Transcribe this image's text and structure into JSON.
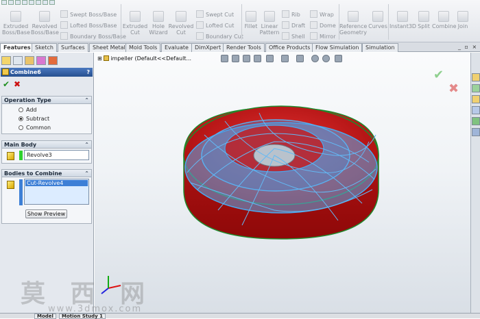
{
  "toolbar": {
    "extruded_boss": "Extruded\nBoss/Base",
    "revolved_boss": "Revolved\nBoss/Base",
    "swept_boss": "Swept Boss/Base",
    "lofted_boss": "Lofted Boss/Base",
    "boundary_boss": "Boundary Boss/Base",
    "extruded_cut": "Extruded\nCut",
    "hole_wizard": "Hole\nWizard",
    "revolved_cut": "Revolved\nCut",
    "swept_cut": "Swept Cut",
    "lofted_cut": "Lofted Cut",
    "boundary_cut": "Boundary Cut",
    "fillet": "Fillet",
    "linear_pattern": "Linear\nPattern",
    "rib": "Rib",
    "draft": "Draft",
    "shell": "Shell",
    "wrap": "Wrap",
    "dome": "Dome",
    "mirror": "Mirror",
    "reference_geometry": "Reference\nGeometry",
    "curves": "Curves",
    "instant3d": "Instant3D",
    "split": "Split",
    "combine": "Combine",
    "join": "Join"
  },
  "tabs": [
    "Features",
    "Sketch",
    "Surfaces",
    "Sheet Metal",
    "Mold Tools",
    "Evaluate",
    "DimXpert",
    "Render Tools",
    "Office Products",
    "Flow Simulation",
    "Simulation"
  ],
  "active_tab": "Features",
  "property_manager": {
    "title": "Combine6",
    "help": "?",
    "ok": "✔",
    "cancel": "✖",
    "operation_type": {
      "heading": "Operation Type",
      "options": [
        "Add",
        "Subtract",
        "Common"
      ],
      "selected": "Subtract"
    },
    "main_body": {
      "heading": "Main Body",
      "value": "Revolve3"
    },
    "bodies_to_combine": {
      "heading": "Bodies to Combine",
      "items": [
        "Cut-Revolve4"
      ]
    },
    "show_preview": "Show Preview",
    "collapse_glyph": "⌃"
  },
  "viewport": {
    "breadcrumb": "impeller  (Default<<Default...",
    "accent_colors": {
      "body": "#c41212",
      "sweep": "#4aa8ee",
      "edge": "#1f8a2c"
    }
  },
  "bottom_tabs": [
    "Model",
    "Motion Study 1"
  ],
  "watermark": {
    "main": "莫 西 网",
    "url": "www.3dmox.com"
  }
}
